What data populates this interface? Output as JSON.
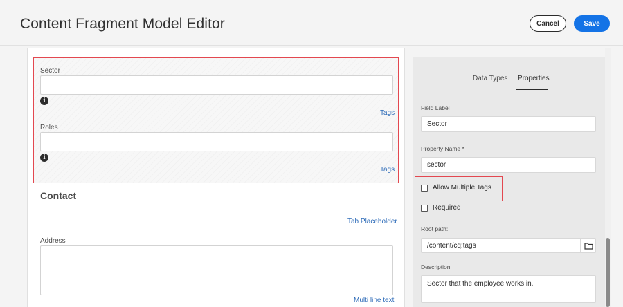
{
  "header": {
    "title": "Content Fragment Model Editor",
    "cancel_label": "Cancel",
    "save_label": "Save"
  },
  "editor": {
    "sector": {
      "label": "Sector",
      "value": "",
      "type_link": "Tags"
    },
    "roles": {
      "label": "Roles",
      "value": "",
      "type_link": "Tags"
    },
    "info_glyph": "i",
    "contact": {
      "title": "Contact",
      "type_link": "Tab Placeholder"
    },
    "address": {
      "label": "Address",
      "value": "",
      "type_link": "Multi line text"
    }
  },
  "properties_panel": {
    "tabs": [
      {
        "label": "Data Types",
        "active": false
      },
      {
        "label": "Properties",
        "active": true
      }
    ],
    "field_label": {
      "label": "Field Label",
      "value": "Sector"
    },
    "property_name": {
      "label": "Property Name *",
      "value": "sector"
    },
    "allow_multiple_tags": {
      "label": "Allow Multiple Tags",
      "checked": false
    },
    "required": {
      "label": "Required",
      "checked": false
    },
    "root_path": {
      "label": "Root path:",
      "value": "/content/cq:tags"
    },
    "description": {
      "label": "Description",
      "value": "Sector that the employee works in."
    }
  },
  "colors": {
    "accent": "#1473e6",
    "link": "#2d6bb8",
    "selection": "#e34850"
  },
  "icons": [
    "info-icon",
    "folder-icon"
  ]
}
